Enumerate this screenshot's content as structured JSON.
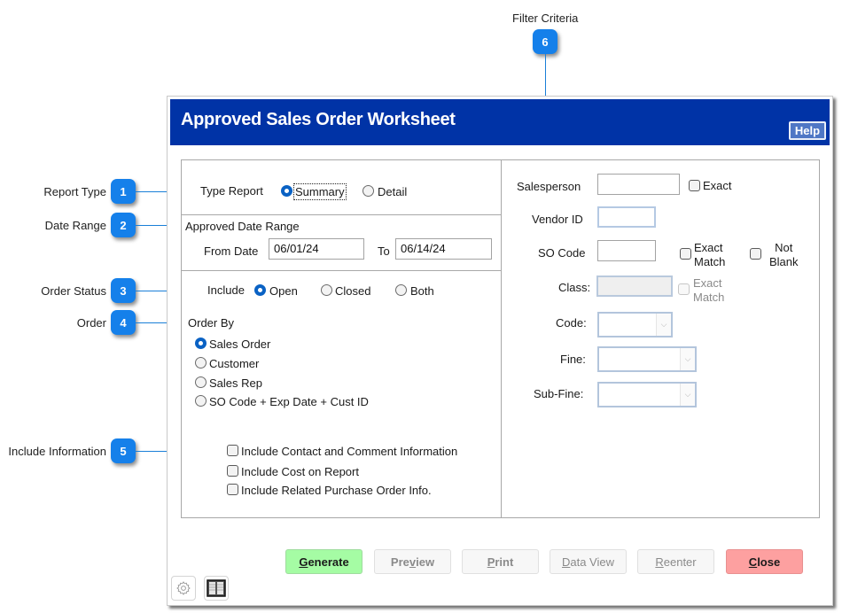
{
  "callouts": [
    {
      "num": "1",
      "label": "Report Type"
    },
    {
      "num": "2",
      "label": "Date Range"
    },
    {
      "num": "3",
      "label": "Order Status"
    },
    {
      "num": "4",
      "label": "Order"
    },
    {
      "num": "5",
      "label": "Include Information"
    },
    {
      "num": "6",
      "label": "Filter Criteria"
    }
  ],
  "window": {
    "title": "Approved Sales Order Worksheet",
    "help_label": "Help"
  },
  "report_type": {
    "label": "Type Report",
    "options": [
      {
        "label": "Summary",
        "selected": true
      },
      {
        "label": "Detail",
        "selected": false
      }
    ]
  },
  "date_range": {
    "heading": "Approved Date Range",
    "from_label": "From Date",
    "from_value": "06/01/24",
    "to_label": "To",
    "to_value": "06/14/24"
  },
  "order_status": {
    "label": "Include",
    "options": [
      {
        "label": "Open",
        "selected": true
      },
      {
        "label": "Closed",
        "selected": false
      },
      {
        "label": "Both",
        "selected": false
      }
    ]
  },
  "order_by": {
    "heading": "Order By",
    "options": [
      {
        "label": "Sales Order",
        "selected": true
      },
      {
        "label": "Customer",
        "selected": false
      },
      {
        "label": "Sales Rep",
        "selected": false
      },
      {
        "label": "SO Code + Exp Date + Cust ID",
        "selected": false
      }
    ]
  },
  "include_info": [
    {
      "label": "Include Contact and Comment Information",
      "checked": false
    },
    {
      "label": "Include Cost on Report",
      "checked": false
    },
    {
      "label": "Include Related Purchase Order Info.",
      "checked": false
    }
  ],
  "filters": {
    "salesperson": {
      "label": "Salesperson",
      "value": "",
      "exact_label": "Exact",
      "exact_checked": false
    },
    "vendor_id": {
      "label": "Vendor ID",
      "value": ""
    },
    "so_code": {
      "label": "SO Code",
      "value": "",
      "exact_line1": "Exact",
      "exact_line2": "Match",
      "notblank_line1": "Not",
      "notblank_line2": "Blank"
    },
    "class": {
      "label": "Class:",
      "value": "",
      "exact_line1": "Exact",
      "exact_line2": "Match"
    },
    "code": {
      "label": "Code:",
      "value": ""
    },
    "fine": {
      "label": "Fine:",
      "value": ""
    },
    "sub_fine": {
      "label": "Sub-Fine:",
      "value": ""
    }
  },
  "buttons": {
    "generate": {
      "pre": "",
      "key": "G",
      "post": "enerate"
    },
    "preview": {
      "pre": "Pre",
      "key": "v",
      "post": "iew"
    },
    "print": {
      "pre": "",
      "key": "P",
      "post": "rint"
    },
    "data_view": {
      "pre": "",
      "key": "D",
      "post": "ata View"
    },
    "reenter": {
      "pre": "",
      "key": "R",
      "post": "eenter"
    },
    "close": {
      "pre": "",
      "key": "C",
      "post": "lose"
    }
  },
  "colors": {
    "titlebar": "#0033a6",
    "callout_badge": "#1580ea",
    "generate": "#a5fca4",
    "close": "#fda0a0"
  }
}
